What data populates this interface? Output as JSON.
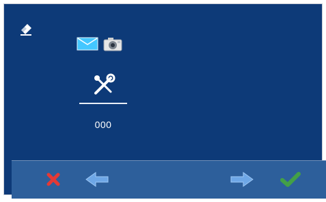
{
  "screen": {
    "value": "000"
  },
  "icons": {
    "eraser": "eraser-icon",
    "mail": "mail-icon",
    "camera": "camera-icon",
    "tools": "tools-icon",
    "cancel": "close-icon",
    "back": "arrow-left-icon",
    "forward": "arrow-right-icon",
    "confirm": "check-icon"
  },
  "colors": {
    "background": "#0d3a78",
    "bar": "#2d5f9b",
    "cancel": "#e53935",
    "confirm": "#43a047",
    "arrow": "#6ea7e6"
  }
}
